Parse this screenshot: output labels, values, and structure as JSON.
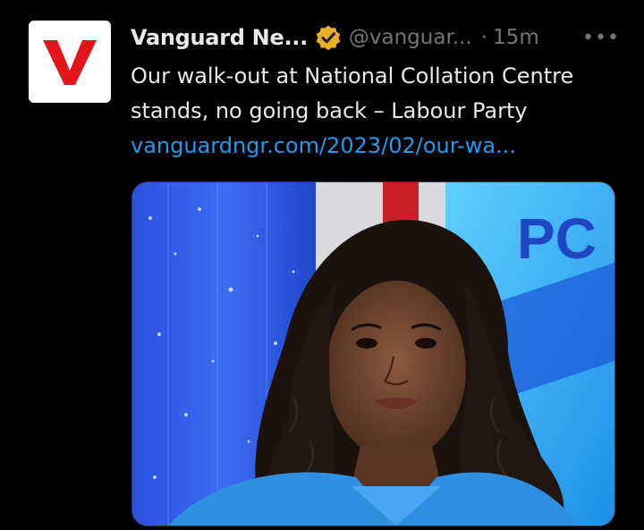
{
  "tweet": {
    "author": {
      "display_name": "Vanguard Ne...",
      "handle": "@vanguar...",
      "avatar_letter": "V",
      "verified_badge_color": "#e8b02a"
    },
    "separator": "·",
    "timestamp": "15m",
    "more_label": "•••",
    "text_lines": [
      "Our walk-out at National Collation Centre",
      "stands, no going back – Labour Party"
    ],
    "link": "vanguardngr.com/2023/02/our-wa...",
    "media": {
      "overlay_text": "PC"
    }
  },
  "colors": {
    "background": "#000000",
    "primary_text": "#e7e9ea",
    "secondary_text": "#71767b",
    "link": "#1d9bf0",
    "brand_red": "#e3141c"
  }
}
